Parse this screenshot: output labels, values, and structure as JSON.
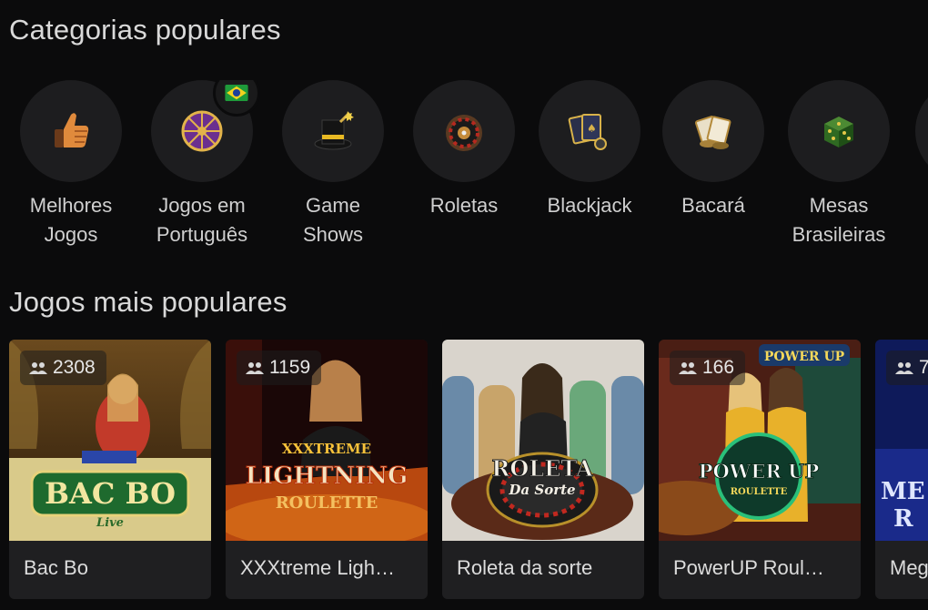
{
  "sections": {
    "categories_title": "Categorias populares",
    "games_title": "Jogos mais populares"
  },
  "categories": [
    {
      "label": "Melhores\nJogos",
      "icon": "thumbs-up-icon"
    },
    {
      "label": "Jogos em\nPortuguês",
      "icon": "wheel-icon",
      "badge": "brazil-flag-icon"
    },
    {
      "label": "Game\nShows",
      "icon": "top-hat-icon"
    },
    {
      "label": "Roletas",
      "icon": "roulette-icon"
    },
    {
      "label": "Blackjack",
      "icon": "cards-icon"
    },
    {
      "label": "Bacará",
      "icon": "baccarat-chips-icon"
    },
    {
      "label": "Mesas\nBrasileiras",
      "icon": "dice-icon"
    }
  ],
  "games": [
    {
      "name": "Bac Bo",
      "players": "2308",
      "logo": "BAC BO",
      "logo_sub": "Live"
    },
    {
      "name": "XXXtreme Ligh…",
      "players": "1159",
      "logo": "LIGHTNING",
      "logo_top": "XXXTREME",
      "logo_sub": "ROULETTE"
    },
    {
      "name": "Roleta da sorte",
      "players": "",
      "logo": "ROLETA",
      "logo_sub": "Da Sorte"
    },
    {
      "name": "PowerUP Roul…",
      "players": "166",
      "logo": "POWER UP",
      "logo_sub": "ROULETTE"
    },
    {
      "name": "Meg",
      "players": "7"
    }
  ],
  "colors": {
    "background": "#0b0b0c",
    "card": "#1f1f21",
    "circle": "#1d1d1f",
    "text": "#d6d6d6"
  }
}
